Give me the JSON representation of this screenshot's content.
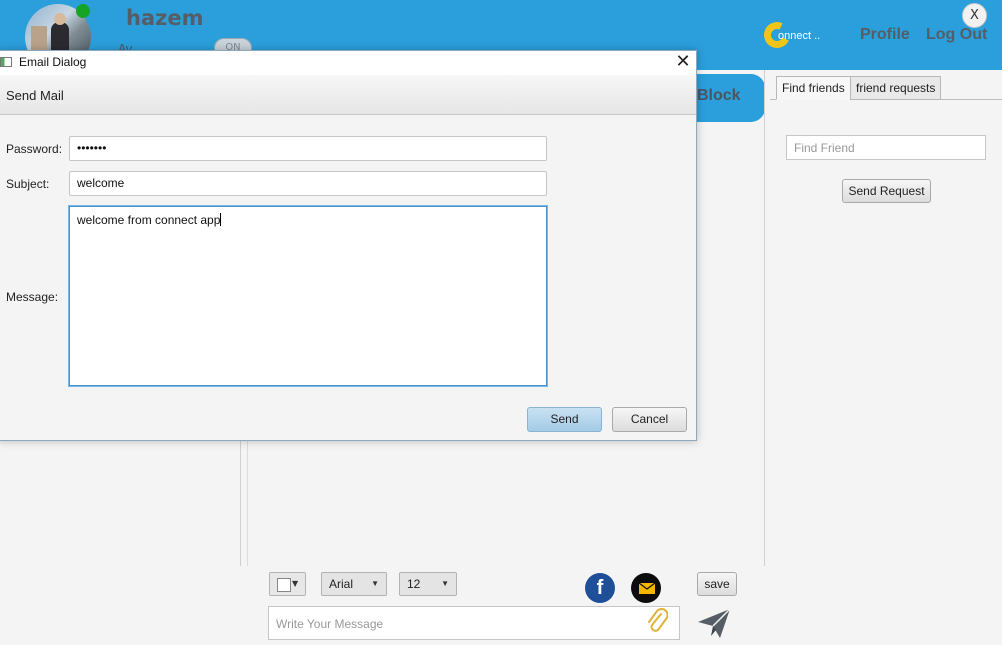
{
  "app": {
    "username": "hazem",
    "status_text": "Av...",
    "status_toggle": "ON",
    "logo_text": "onnect ..",
    "nav": {
      "profile": "Profile",
      "logout": "Log Out"
    },
    "close_label": "X"
  },
  "chat": {
    "block_label": "Block"
  },
  "right_panel": {
    "tabs": [
      "Find friends",
      "friend requests"
    ],
    "find_placeholder": "Find Friend",
    "send_request_label": "Send Request"
  },
  "toolbar": {
    "font_family": "Arial",
    "font_size": "12",
    "save_label": "save",
    "message_placeholder": "Write Your Message",
    "facebook_glyph": "f"
  },
  "dialog": {
    "window_title": "Email Dialog",
    "header": "Send Mail",
    "password_label": "Password:",
    "password_value": "•••••••",
    "subject_label": "Subject:",
    "subject_value": "welcome",
    "message_label": "Message:",
    "message_value": "welcome from connect app",
    "send_label": "Send",
    "cancel_label": "Cancel"
  },
  "colors": {
    "header_blue": "#2b9fdb",
    "online_green": "#17a326",
    "logo_yellow": "#f0c419",
    "facebook_blue": "#1f4f99",
    "mail_yellow": "#f7b500"
  }
}
